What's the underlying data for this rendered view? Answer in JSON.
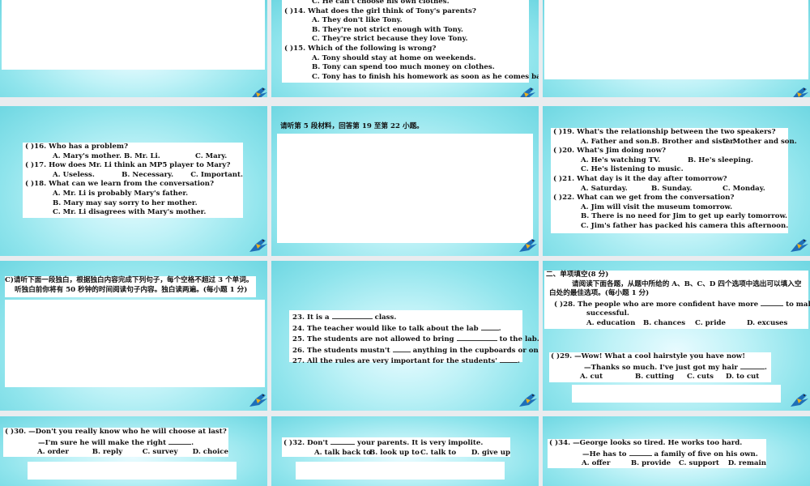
{
  "slides": {
    "s1": {},
    "s2": {
      "q13_optC": "C. He can't choose his own clothes.",
      "q14": "(      )14. What does the girl think of Tony's parents?",
      "q14_optA": "A. They don't like Tony.",
      "q14_optB": "B. They're not strict enough with Tony.",
      "q14_optC": "C. They're strict because they love Tony.",
      "q15": "(      )15. Which of the following is wrong?",
      "q15_optA": "A. Tony should stay at home on weekends.",
      "q15_optB": "B. Tony can spend too much money on clothes.",
      "q15_optC": "C. Tony has to finish his homework as soon as he comes back from school."
    },
    "s3": {},
    "s4": {
      "q16": "(      )16. Who has a problem?",
      "q16_opts": [
        "A. Mary's mother.",
        "B. Mr. Li.",
        "C. Mary."
      ],
      "q17": "(      )17. How does Mr. Li think an MP5 player to Mary?",
      "q17_opts": [
        "A. Useless.",
        "B. Necessary.",
        "C. Important."
      ],
      "q18": "(      )18. What can we learn from the conversation?",
      "q18_optA": "A. Mr. Li is probably Mary's father.",
      "q18_optB": "B. Mary may say sorry to her mother.",
      "q18_optC": "C. Mr. Li disagrees with Mary's mother."
    },
    "s5": {
      "instruction": "请听第 5 段材料，回答第 19 至第 22 小题。"
    },
    "s6": {
      "q19": "(      )19. What's the relationship between the two speakers?",
      "q19_opts": [
        "A. Father and son.",
        "B. Brother and sister.",
        "C. Mother and son."
      ],
      "q20": "(      )20. What's Jim doing now?",
      "q20_optA": "A. He's watching TV.",
      "q20_optB": "B. He's sleeping.",
      "q20_optC": "C. He's listening to music.",
      "q21": "(      )21. What day is it the day after tomorrow?",
      "q21_opts": [
        "A. Saturday.",
        "B. Sunday.",
        "C. Monday."
      ],
      "q22": "(      )22. What can we get from the conversation?",
      "q22_optA": "A. Jim will visit the museum tomorrow.",
      "q22_optB": "B. There is no need for Jim to get up early tomorrow.",
      "q22_optC": "C. Jim's father has packed his camera this afternoon."
    },
    "s7": {
      "line1": "C)请听下面一段独白，根据独白内容完成下列句子，每个空格不超过 3 个单词。",
      "line2": "听独白前你将有 50 秒钟的时间阅读句子内容。独白读两遍。(每小题 1 分)"
    },
    "s8": {
      "q23a": "23. It is a",
      "q23b": "class.",
      "q24a": "24. The teacher would like to talk about the lab",
      "q24b": ".",
      "q25a": "25. The students are not allowed to bring",
      "q25b": "to the lab.",
      "q26a": "26. The students mustn't",
      "q26b": "anything in the cupboards or on the shelves.",
      "q27a": "27. All the rules are very important for the students'",
      "q27b": "."
    },
    "s9": {
      "section": "二、单项填空(8 分)",
      "instr1": "请阅读下面各题，从题中所给的 A、B、C、D 四个选项中选出可以填入空",
      "instr2": "白处的最佳选项。(每小题 1 分)",
      "q28a": "(      )28. The people who are more confident have more",
      "q28b": "to make themselves",
      "q28c": "successful.",
      "q28_opts": [
        "A. education",
        "B. chances",
        "C. pride",
        "D. excuses"
      ],
      "q29a": "(      )29. —Wow!  What a cool hairstyle you have now!",
      "q29b": "—Thanks so much. I've just got my hair",
      "q29c": ".",
      "q29_opts": [
        "A. cut",
        "B. cutting",
        "C. cuts",
        "D. to cut"
      ]
    },
    "s10": {
      "q30a": "(      )30. —Don't you really know who he will choose at last?",
      "q30b": "—I'm sure he will make the right",
      "q30c": ".",
      "q30_opts": [
        "A. order",
        "B. reply",
        "C. survey",
        "D. choice"
      ]
    },
    "s11": {
      "q32a": "(      )32. Don't",
      "q32b": "your parents. It is very impolite.",
      "q32_opts": [
        "A. talk back to",
        "B. look up to",
        "C. talk to",
        "D. give up"
      ]
    },
    "s12": {
      "q34a": "(      )34. —George looks so tired. He works too hard.",
      "q34b": "—He has to",
      "q34c": "a family of five on his own.",
      "q34_opts": [
        "A. offer",
        "B. provide",
        "C. support",
        "D. remain"
      ]
    }
  }
}
